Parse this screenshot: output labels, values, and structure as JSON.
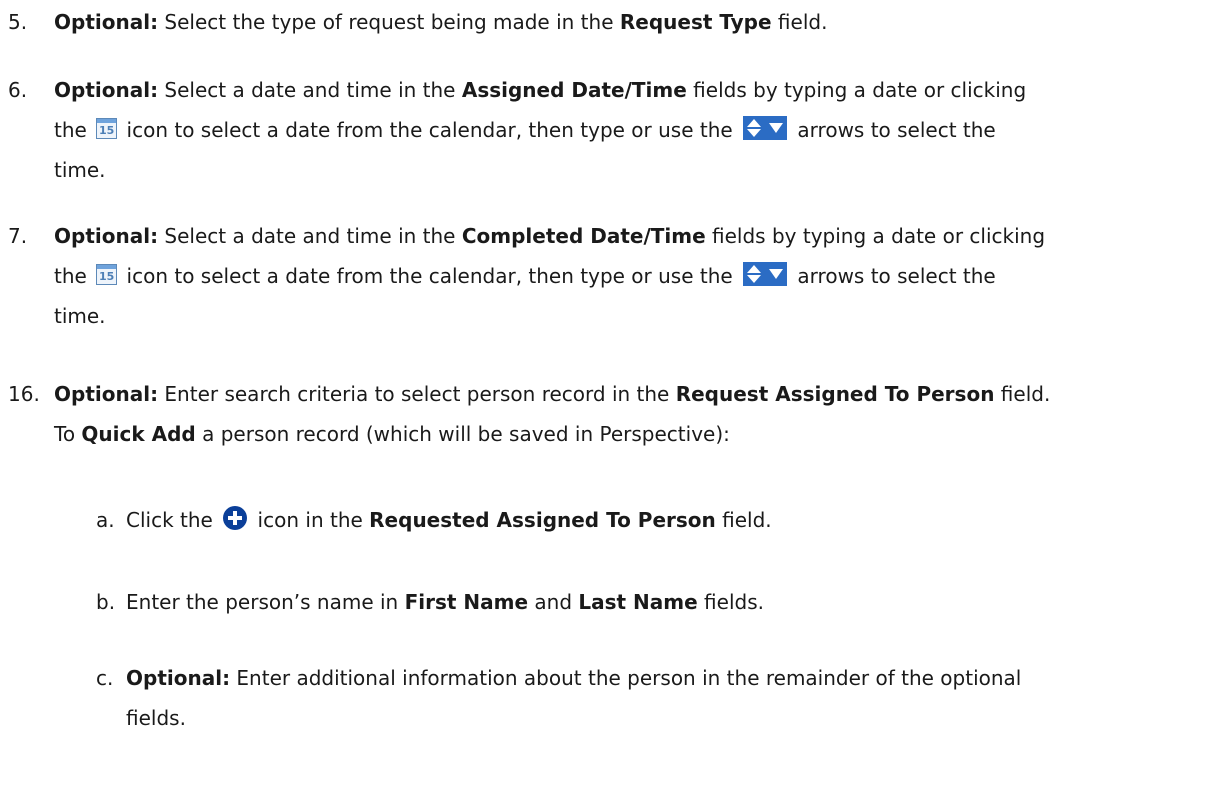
{
  "items": [
    {
      "number": "5.",
      "opt": "Optional:",
      "t1": " Select the type of request being made in the ",
      "b1": "Request Type",
      "t2": " field."
    },
    {
      "number": "6.",
      "opt": "Optional:",
      "t1": " Select a date and time in the ",
      "b1": "Assigned Date/Time",
      "t2": " fields by typing a date or clicking",
      "l2a": "the",
      "cal": "15",
      "l2b": " icon to select a date from the calendar, then type or use the ",
      "l2c": " arrows to select the",
      "l3": "time."
    },
    {
      "number": "7.",
      "opt": "Optional:",
      "t1": " Select a date and time in the ",
      "b1": "Completed Date/Time",
      "t2": " fields by typing a date or clicking",
      "l2a": "the",
      "cal": "15",
      "l2b": " icon to select a date from the calendar, then type or use the ",
      "l2c": " arrows to select the",
      "l3": "time."
    },
    {
      "number": "16.",
      "opt": "Optional:",
      "t1": " Enter search criteria to select person record in the ",
      "b1": "Request Assigned To Person",
      "t2": " field.",
      "l2a": "To ",
      "b2": "Quick Add",
      "l2b": " a person record (which will be saved in Perspective):"
    }
  ],
  "subitems": [
    {
      "letter": "a.",
      "t1": "Click the",
      "t2": " icon in the ",
      "b1": "Requested Assigned To Person",
      "t3": " field."
    },
    {
      "letter": "b.",
      "t1": "Enter the person’s name in ",
      "b1": "First Name",
      "t2": " and ",
      "b2": "Last Name",
      "t3": " fields."
    },
    {
      "letter": "c.",
      "opt": "Optional:",
      "t1": " Enter additional information about the person in the remainder of the optional",
      "l2": "fields."
    }
  ],
  "icons": {
    "calendar": "calendar-icon",
    "spin": "up-down-arrows-icon",
    "add": "add-circle-icon"
  },
  "colors": {
    "text": "#1a1a1a",
    "icon_blue": "#2b6cc4",
    "add_icon": "#0b3f99"
  }
}
